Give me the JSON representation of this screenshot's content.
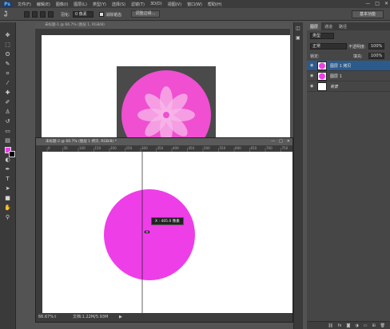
{
  "app": {
    "logo": "Ps"
  },
  "menubar": {
    "items": [
      "文件(F)",
      "编辑(E)",
      "图像(I)",
      "图层(L)",
      "类型(Y)",
      "选择(S)",
      "滤镜(T)",
      "3D(D)",
      "视图(V)",
      "窗口(W)",
      "帮助(H)"
    ]
  },
  "window_controls": {
    "minimize": "—",
    "maximize": "□",
    "close": "✕"
  },
  "options": {
    "feather_label": "羽化:",
    "feather_value": "0 像素",
    "antialias_label": "消除锯齿",
    "refine_edge": "调整边缘..."
  },
  "workspace": {
    "label": "基本功能"
  },
  "toolbox": {
    "icons": [
      "move-icon",
      "marquee-icon",
      "lasso-icon",
      "quick-select-icon",
      "crop-icon",
      "eyedropper-icon",
      "healing-icon",
      "brush-icon",
      "stamp-icon",
      "history-brush-icon",
      "eraser-icon",
      "gradient-icon",
      "blur-icon",
      "dodge-icon",
      "pen-icon",
      "type-icon",
      "path-select-icon",
      "shape-icon",
      "hand-icon",
      "zoom-icon"
    ],
    "foreground_color": "#ee3ee8",
    "background_color": "#000000"
  },
  "layers_panel": {
    "tabs": [
      "图层",
      "通道",
      "路径"
    ],
    "filter_kind": "类型",
    "blend_mode": "正常",
    "opacity_label": "不透明度:",
    "opacity_value": "100%",
    "lock_label": "锁定:",
    "fill_label": "填充:",
    "fill_value": "100%",
    "layers": [
      {
        "name": "图层 1 拷贝",
        "selected": true,
        "thumb": "pink"
      },
      {
        "name": "图层 1",
        "selected": false,
        "thumb": "pink"
      },
      {
        "name": "背景",
        "selected": false,
        "thumb": "white"
      }
    ]
  },
  "doc_back": {
    "title": "未标题-1 @ 66.7% (图层 1, RGB/8)",
    "icon_bg": "#4a4a4a",
    "circle_color": "#ef4fd0",
    "petal_color": "#f7b8ea"
  },
  "doc_front": {
    "title": "未标题-2 @ 66.7% (图层 1 拷贝, RGB/8) *",
    "ruler_ticks": [
      "0",
      "50",
      "100",
      "150",
      "200",
      "250",
      "300",
      "350",
      "400",
      "450",
      "500",
      "550",
      "600",
      "650",
      "700",
      "750"
    ],
    "circle_color": "#ee3ee8",
    "tooltip": "X : 405.0 像素",
    "zoom": "66.67%",
    "doc_info": "文档:1.22M/5.93M"
  }
}
